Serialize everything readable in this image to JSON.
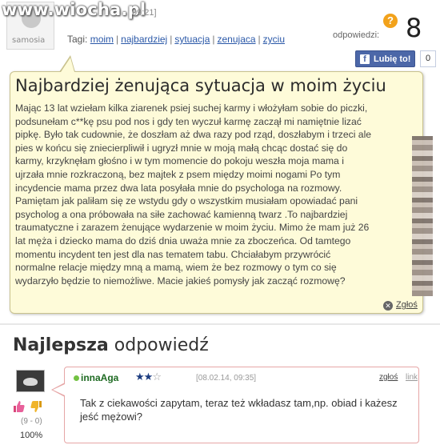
{
  "watermark": "www.wiocha.pl",
  "question": {
    "avatar_text": "samosia",
    "date_fragment": "09:21]",
    "tags_label": "Tagi:",
    "tags": [
      "moim",
      "najbardziej",
      "sytuacja",
      "zenujaca",
      "zyciu"
    ],
    "answers_label": "odpowiedzi:",
    "answers_count": "8",
    "answers_icon": "question-mark-icon",
    "title": "Najbardziej żenująca sytuacja w moim życiu",
    "body_lines": [
      "Mając 13 lat wziełam kilka ziarenek psiej suchej karmy i włożyłam sobie do piczki,",
      "podsunełam c**kę psu pod nos i gdy ten wyczuł karmę zaczął mi namiętnie lizać",
      "pipkę. Było tak cudownie, że doszłam aż dwa razy pod rząd, doszłabym i trzeci ale",
      "pies w końcu się zniecierpliwił i ugryzł mnie w moją małą chcąc dostać się do",
      "karmy, krzyknęłam głośno i w tym momencie do pokoju weszła moja mama i",
      "ujrzała mnie rozkraczoną, bez majtek z psem między moimi nogami Po tym",
      "incydencie mama przez dwa lata posyłała mnie do psychologa na rozmowy.",
      "Pamiętam jak paliłam się ze wstydu gdy o wszystkim musiałam opowiadać pani",
      "psycholog a ona próbowała na siłe zachować kamienną twarz .To najbardziej",
      "traumatyczne i zarazem żenujące wydarzenie w moim życiu. Mimo że mam już 26",
      "lat męża i dziecko mama do dziś dnia uważa mnie za zboczeńca. Od tamtego",
      "momentu incydent ten jest dla nas tematem tabu. Chciałabym przywrócić",
      "normalne relacje między mną a mamą, wiem że bez rozmowy o tym co się",
      "wydarzyło będzie to niemożliwe. Macie jakieś pomysły jak zacząć rozmowę?"
    ],
    "report_label": "Zgłoś",
    "report_icon": "close-circle-icon"
  },
  "facebook": {
    "like_label": "Lubię to!",
    "count": "0",
    "icon": "facebook-f-icon"
  },
  "best_answer": {
    "heading_bold": "Najlepsza",
    "heading_regular": "odpowiedź",
    "user": "innaAga",
    "stars_filled": "★★",
    "stars_empty": "☆",
    "date": "[08.02.14, 09:35]",
    "report_label": "zgłoś",
    "link_label": "link",
    "body_lines": [
      "Tak z ciekawości zapytam, teraz też wkładasz tam,np. obiad i każesz",
      "jeść mężowi?"
    ],
    "votes": "(9 - 0)",
    "percent": "100%",
    "thumb_up_icon": "thumb-up-icon",
    "thumb_down_icon": "thumb-down-icon"
  }
}
